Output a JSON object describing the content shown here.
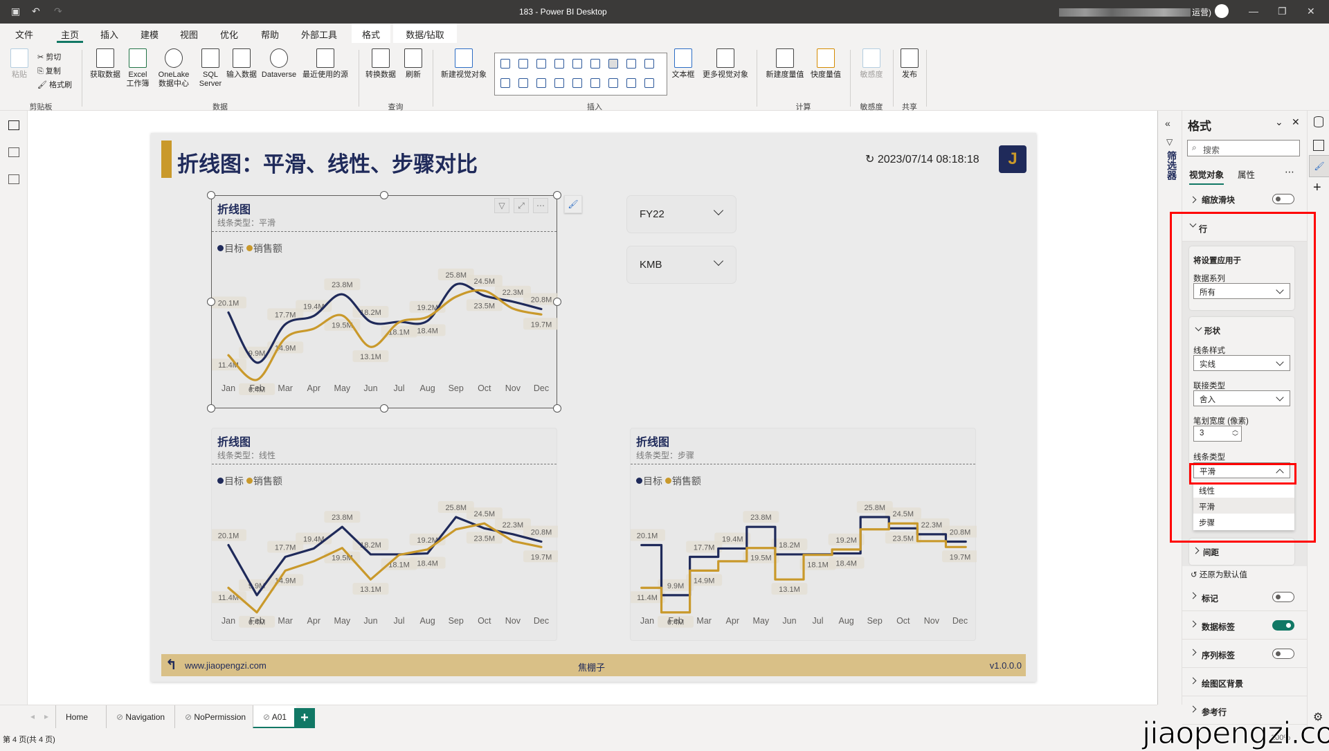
{
  "window": {
    "title": "183 - Power BI Desktop",
    "user_suffix": "运营)"
  },
  "menu": [
    "文件",
    "主页",
    "插入",
    "建模",
    "视图",
    "优化",
    "帮助",
    "外部工具",
    "格式",
    "数据/钻取"
  ],
  "ribbon": {
    "clipboard": {
      "paste": "粘贴",
      "cut": "剪切",
      "copy": "复制",
      "format_painter": "格式刷",
      "group": "剪贴板"
    },
    "data": {
      "get_data": "获取数据",
      "excel": "Excel 工作簿",
      "onelake": "OneLake 数据中心",
      "sql": "SQL Server",
      "enter_data": "输入数据",
      "dataverse": "Dataverse",
      "recent": "最近使用的源",
      "group": "数据"
    },
    "query": {
      "transform": "转换数据",
      "refresh": "刷新",
      "group": "查询"
    },
    "insert": {
      "new_visual": "新建视觉对象",
      "textbox": "文本框",
      "more_visuals": "更多视觉对象",
      "group": "插入"
    },
    "calc": {
      "new_measure": "新建度量值",
      "quick_measure": "快度量值",
      "group": "计算"
    },
    "sensitivity": {
      "label": "敏感度",
      "group": "敏感度"
    },
    "share": {
      "publish": "发布",
      "group": "共享"
    }
  },
  "report": {
    "title": "折线图：平滑、线性、步骤对比",
    "refresh_time": "↻ 2023/07/14 08:18:18",
    "badge": "J",
    "slicers": [
      "FY22",
      "KMB"
    ],
    "footer": {
      "url": "www.jiaopengzi.com",
      "author": "焦棚子",
      "version": "v1.0.0.0"
    },
    "legend": [
      "目标",
      "销售额"
    ]
  },
  "colors": {
    "target": "#1f2a5a",
    "sales": "#c9992b",
    "accent": "#117865"
  },
  "chart_data": [
    {
      "type": "line",
      "title": "折线图",
      "subtitle": "线条类型：平滑",
      "line_type": "smooth",
      "categories": [
        "Jan",
        "Feb",
        "Mar",
        "Apr",
        "May",
        "Jun",
        "Jul",
        "Aug",
        "Sep",
        "Oct",
        "Nov",
        "Dec"
      ],
      "series": [
        {
          "name": "目标",
          "values": [
            20.1,
            9.9,
            17.7,
            19.4,
            23.8,
            18.2,
            18.2,
            18.4,
            25.8,
            23.5,
            22.3,
            20.8
          ]
        },
        {
          "name": "销售额",
          "values": [
            11.4,
            6.4,
            14.9,
            16.8,
            19.5,
            13.1,
            18.1,
            19.2,
            23.3,
            24.5,
            20.9,
            19.7
          ]
        }
      ],
      "labels": [
        [
          "20.1M",
          "9.9M",
          "17.7M",
          "19.4M",
          "23.8M",
          "18.2M",
          null,
          "18.4M",
          "25.8M",
          "23.5M",
          "22.3M",
          "20.8M"
        ],
        [
          "11.4M",
          "6.4M",
          "14.9M",
          null,
          "19.5M",
          "13.1M",
          "18.1M",
          "19.2M",
          null,
          "24.5M",
          null,
          "19.7M"
        ]
      ]
    },
    {
      "type": "line",
      "title": "折线图",
      "subtitle": "线条类型：线性",
      "line_type": "linear",
      "categories": [
        "Jan",
        "Feb",
        "Mar",
        "Apr",
        "May",
        "Jun",
        "Jul",
        "Aug",
        "Sep",
        "Oct",
        "Nov",
        "Dec"
      ],
      "series": [
        {
          "name": "目标",
          "values": [
            20.1,
            9.9,
            17.7,
            19.4,
            23.8,
            18.2,
            18.2,
            18.4,
            25.8,
            23.5,
            22.3,
            20.8
          ]
        },
        {
          "name": "销售额",
          "values": [
            11.4,
            6.4,
            14.9,
            16.8,
            19.5,
            13.1,
            18.1,
            19.2,
            23.3,
            24.5,
            20.9,
            19.7
          ]
        }
      ],
      "labels": [
        [
          "20.1M",
          "9.9M",
          "17.7M",
          "19.4M",
          "23.8M",
          "18.2M",
          null,
          "18.4M",
          "25.8M",
          "23.5M",
          "22.3M",
          "20.8M"
        ],
        [
          "11.4M",
          "6.4M",
          "14.9M",
          null,
          "19.5M",
          "13.1M",
          "18.1M",
          "19.2M",
          null,
          "24.5M",
          null,
          "19.7M"
        ]
      ]
    },
    {
      "type": "line",
      "title": "折线图",
      "subtitle": "线条类型：步骤",
      "line_type": "step",
      "categories": [
        "Jan",
        "Feb",
        "Mar",
        "Apr",
        "May",
        "Jun",
        "Jul",
        "Aug",
        "Sep",
        "Oct",
        "Nov",
        "Dec"
      ],
      "series": [
        {
          "name": "目标",
          "values": [
            20.1,
            9.9,
            17.7,
            19.4,
            23.8,
            18.2,
            18.2,
            18.4,
            25.8,
            23.5,
            22.3,
            20.8
          ]
        },
        {
          "name": "销售额",
          "values": [
            11.4,
            6.4,
            14.9,
            16.8,
            19.5,
            13.1,
            18.1,
            19.2,
            23.3,
            24.5,
            20.9,
            19.7
          ]
        }
      ],
      "labels": [
        [
          "20.1M",
          "9.9M",
          "17.7M",
          "19.4M",
          "23.8M",
          "18.2M",
          null,
          "18.4M",
          "25.8M",
          "23.5M",
          "22.3M",
          "20.8M"
        ],
        [
          "11.4M",
          "6.4M",
          "14.9M",
          null,
          "19.5M",
          "13.1M",
          "18.1M",
          "19.2M",
          null,
          "24.5M",
          null,
          "19.7M"
        ]
      ]
    }
  ],
  "filters_label": "筛选器",
  "format_pane": {
    "title": "格式",
    "search_placeholder": "搜索",
    "tabs": [
      "视觉对象",
      "属性"
    ],
    "zoom_slider": "缩放滑块",
    "lines": "行",
    "apply_to": "将设置应用于",
    "series_label": "数据系列",
    "series_value": "所有",
    "shape": "形状",
    "line_style_label": "线条样式",
    "line_style": "实线",
    "join_label": "联接类型",
    "join": "舍入",
    "stroke_label": "笔划宽度 (像素)",
    "stroke": "3",
    "line_type_label": "线条类型",
    "line_type": "平滑",
    "line_type_options": [
      "线性",
      "平滑",
      "步骤"
    ],
    "spacing": "间距",
    "reset": "还原为默认值",
    "sections": [
      {
        "label": "标记",
        "on": false
      },
      {
        "label": "数据标签",
        "on": true
      },
      {
        "label": "序列标签",
        "on": false
      },
      {
        "label": "绘图区背景"
      },
      {
        "label": "参考行"
      }
    ]
  },
  "pages": [
    "Home",
    "Navigation",
    "NoPermission",
    "A01"
  ],
  "status": "第 4 页(共 4 页)",
  "zoom": "100%",
  "watermark": "jiaopengzi.com"
}
